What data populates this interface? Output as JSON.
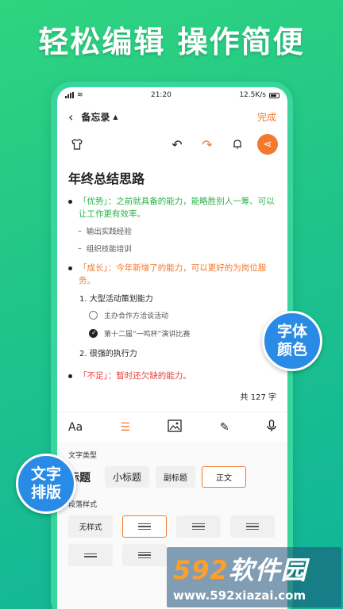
{
  "headline": "轻松编辑  操作简便",
  "status": {
    "time": "21:20",
    "speed": "12.5K/s"
  },
  "nav": {
    "title": "备忘录",
    "done": "完成"
  },
  "doc": {
    "title": "年终总结思路",
    "items": [
      {
        "tag": "「优势」：之前就具备的能力，能略胜别人一筹、可以让工作更有效率。",
        "color": "green"
      },
      {
        "tag": "「成长」：今年新增了的能力，可以更好的为岗位服务。",
        "color": "orange"
      },
      {
        "tag": "「不足」：暂时还欠缺的能力。",
        "color": "red"
      }
    ],
    "subs": [
      "输出实践经验",
      "组织技能培训"
    ],
    "numbered": [
      "1. 大型活动策划能力",
      "2. 很强的执行力"
    ],
    "checks": [
      "主办合作方洽谈活动",
      "第十二届“一鸣杯”演讲比赛"
    ],
    "count": "共 127 字"
  },
  "format_bar": {
    "aa": "Aa"
  },
  "panel": {
    "type_label": "文字类型",
    "types": [
      "标题",
      "小标题",
      "副标题",
      "正文"
    ],
    "style_label": "段落样式",
    "no_style": "无样式"
  },
  "badges": {
    "right": [
      "字体",
      "颜色"
    ],
    "left": [
      "文字",
      "排版"
    ]
  },
  "watermark": {
    "title_a": "592",
    "title_b": "软件园",
    "url": "www.592xiazai.com"
  },
  "colors": {
    "accent": "#f2792d",
    "green": "#2bb34b",
    "red": "#e8413a",
    "badge": "#2a8be6"
  }
}
